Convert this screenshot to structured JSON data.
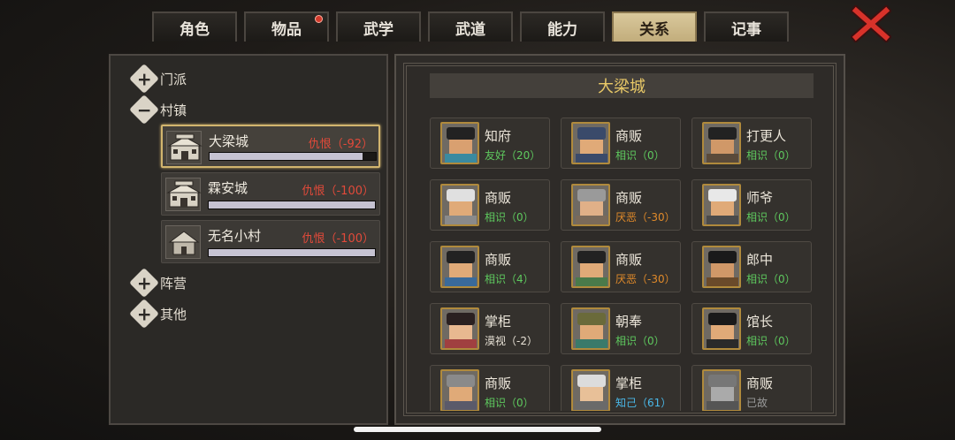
{
  "tabs": [
    {
      "label": "角色",
      "active": false,
      "badge": false
    },
    {
      "label": "物品",
      "active": false,
      "badge": true
    },
    {
      "label": "武学",
      "active": false,
      "badge": false
    },
    {
      "label": "武道",
      "active": false,
      "badge": false
    },
    {
      "label": "能力",
      "active": false,
      "badge": false
    },
    {
      "label": "关系",
      "active": true,
      "badge": false
    },
    {
      "label": "记事",
      "active": false,
      "badge": false
    }
  ],
  "close_icon": "close-x-icon",
  "tree": {
    "menpai": {
      "label": "门派",
      "icon": "expand-plus-icon"
    },
    "cunzhen": {
      "label": "村镇",
      "icon": "collapse-minus-icon"
    },
    "zhenying": {
      "label": "阵营",
      "icon": "expand-plus-icon"
    },
    "qita": {
      "label": "其他",
      "icon": "expand-plus-icon"
    }
  },
  "towns": [
    {
      "name": "大梁城",
      "relation": "仇恨（-92）",
      "progress": 0.92,
      "selected": true,
      "icon": "city-gate-icon"
    },
    {
      "name": "霖安城",
      "relation": "仇恨（-100）",
      "progress": 1.0,
      "selected": false,
      "icon": "city-gate-icon"
    },
    {
      "name": "无名小村",
      "relation": "仇恨（-100）",
      "progress": 1.0,
      "selected": false,
      "icon": "village-house-icon"
    }
  ],
  "city_title": "大梁城",
  "npcs": [
    {
      "name": "知府",
      "relation": "友好（20）",
      "color": "#5ec95e",
      "hat": "#222222",
      "cloth": "#3a8aa0",
      "face": "#d9a070"
    },
    {
      "name": "商贩",
      "relation": "相识（0）",
      "color": "#5ec95e",
      "hat": "#3a4a6a",
      "cloth": "#3a4a6a",
      "face": "#e0aa78"
    },
    {
      "name": "打更人",
      "relation": "相识（0）",
      "color": "#5ec95e",
      "hat": "#222222",
      "cloth": "#5a4a3a",
      "face": "#d09868"
    },
    {
      "name": "商贩",
      "relation": "相识（0）",
      "color": "#5ec95e",
      "hat": "#e0e0e0",
      "cloth": "#8a8a8a",
      "face": "#e0aa78"
    },
    {
      "name": "商贩",
      "relation": "厌恶（-30）",
      "color": "#e08a2a",
      "hat": "#9a9a9a",
      "cloth": "#7a6a5a",
      "face": "#e0b088"
    },
    {
      "name": "师爷",
      "relation": "相识（0）",
      "color": "#5ec95e",
      "hat": "#e8e8e8",
      "cloth": "#4a4a4a",
      "face": "#e0aa78"
    },
    {
      "name": "商贩",
      "relation": "相识（4）",
      "color": "#5ec95e",
      "hat": "#222222",
      "cloth": "#3a6a9a",
      "face": "#e0aa78"
    },
    {
      "name": "商贩",
      "relation": "厌恶（-30）",
      "color": "#e08a2a",
      "hat": "#222222",
      "cloth": "#4a7a4a",
      "face": "#e0aa78"
    },
    {
      "name": "郎中",
      "relation": "相识（0）",
      "color": "#5ec95e",
      "hat": "#1a1a1a",
      "cloth": "#6a4a2a",
      "face": "#d09868"
    },
    {
      "name": "掌柜",
      "relation": "漠视（-2）",
      "color": "#e8e2d6",
      "hat": "#2a2020",
      "cloth": "#a04040",
      "face": "#e8b890"
    },
    {
      "name": "朝奉",
      "relation": "相识（0）",
      "color": "#5ec95e",
      "hat": "#6a6a3a",
      "cloth": "#3a7a6a",
      "face": "#e0aa78"
    },
    {
      "name": "馆长",
      "relation": "相识（0）",
      "color": "#5ec95e",
      "hat": "#1a1a1a",
      "cloth": "#2a2a2a",
      "face": "#e0aa78"
    },
    {
      "name": "商贩",
      "relation": "相识（0）",
      "color": "#5ec95e",
      "hat": "#8a8a8a",
      "cloth": "#5a5a6a",
      "face": "#e0aa78"
    },
    {
      "name": "掌柜",
      "relation": "知己（61）",
      "color": "#4ab8e8",
      "hat": "#dcdcdc",
      "cloth": "#6a6a6a",
      "face": "#e8c098"
    },
    {
      "name": "商贩",
      "relation": "已故",
      "color": "#9a9a9a",
      "hat": "#777777",
      "cloth": "#555555",
      "face": "#aaaaaa"
    }
  ]
}
